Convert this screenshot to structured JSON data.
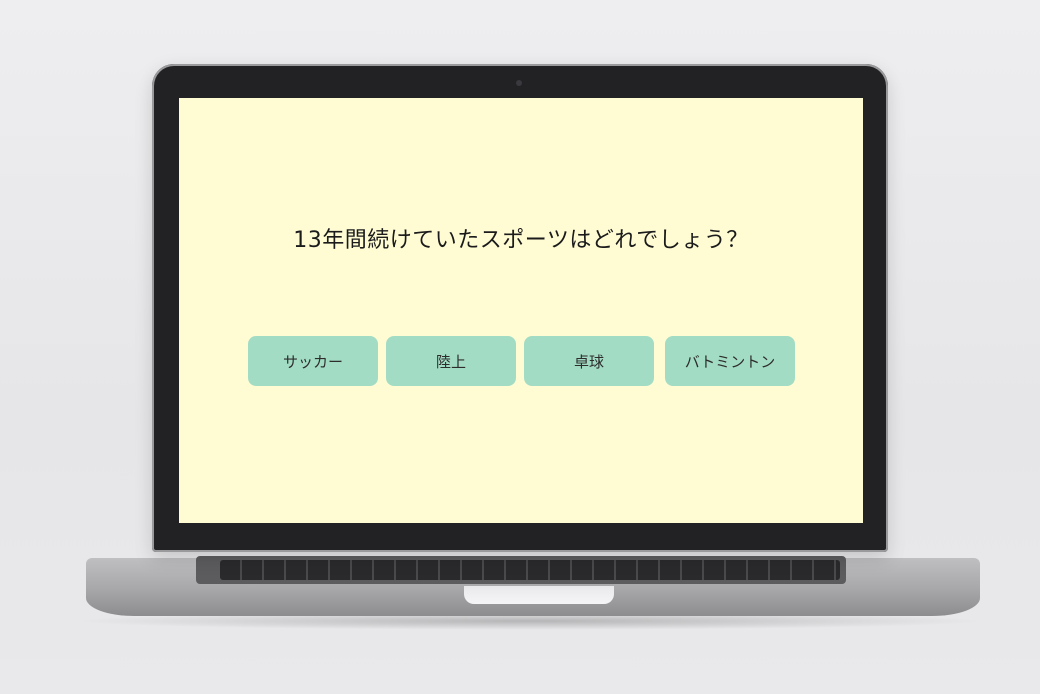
{
  "quiz": {
    "question": "13年間続けていたスポーツはどれでしょう？",
    "choices": [
      {
        "label": "サッカー"
      },
      {
        "label": "陸上"
      },
      {
        "label": "卓球"
      },
      {
        "label": "バトミントン"
      }
    ]
  },
  "colors": {
    "screen_background": "#fffcd4",
    "choice_button": "#a3dcc4",
    "question_text": "#1b1b1b"
  }
}
